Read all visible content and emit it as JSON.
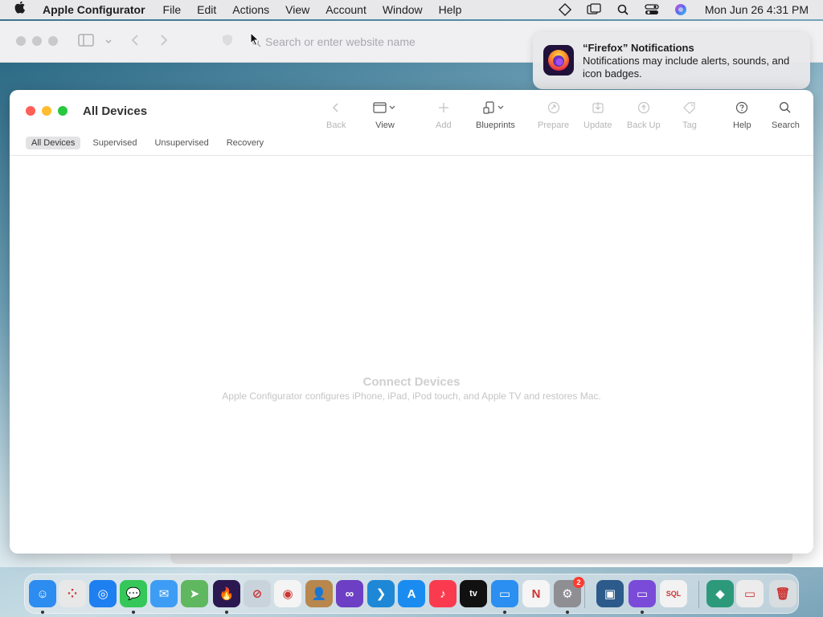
{
  "menubar": {
    "app_name": "Apple Configurator",
    "menus": [
      "File",
      "Edit",
      "Actions",
      "View",
      "Account",
      "Window",
      "Help"
    ],
    "clock": "Mon Jun 26  4:31 PM"
  },
  "safari": {
    "url_placeholder": "Search or enter website name"
  },
  "notification": {
    "title": "“Firefox” Notifications",
    "body": "Notifications may include alerts, sounds, and icon badges."
  },
  "window": {
    "title": "All Devices",
    "toolbar": {
      "back": "Back",
      "view": "View",
      "add": "Add",
      "blueprints": "Blueprints",
      "prepare": "Prepare",
      "update": "Update",
      "backup": "Back Up",
      "tag": "Tag",
      "help": "Help",
      "search": "Search"
    },
    "tabs": [
      "All Devices",
      "Supervised",
      "Unsupervised",
      "Recovery"
    ],
    "active_tab": "All Devices",
    "empty_title": "Connect Devices",
    "empty_subtitle": "Apple Configurator configures iPhone, iPad, iPod touch, and Apple TV and restores Mac."
  },
  "dock": {
    "items": [
      {
        "name": "finder-icon",
        "color": "#2d8cf0",
        "glyph": "☺"
      },
      {
        "name": "launchpad-icon",
        "color": "#e8e8e8",
        "glyph": "⁘"
      },
      {
        "name": "safari-icon",
        "color": "#1e7ff0",
        "glyph": "◎"
      },
      {
        "name": "messages-icon",
        "color": "#35c759",
        "glyph": "💬"
      },
      {
        "name": "mail-icon",
        "color": "#3d9df5",
        "glyph": "✉"
      },
      {
        "name": "maps-icon",
        "color": "#5fb85f",
        "glyph": "➤"
      },
      {
        "name": "firefox-icon",
        "color": "#2b1850",
        "glyph": "🔥"
      },
      {
        "name": "network-utility-icon",
        "color": "#c8d3dc",
        "glyph": "⊘"
      },
      {
        "name": "chrome-icon",
        "color": "#f4f4f4",
        "glyph": "◉"
      },
      {
        "name": "contacts-icon",
        "color": "#b8874e",
        "glyph": "👤"
      },
      {
        "name": "visual-studio-icon",
        "color": "#6c3fc4",
        "glyph": "∞"
      },
      {
        "name": "vscode-icon",
        "color": "#1e88d6",
        "glyph": "❯"
      },
      {
        "name": "app-store-icon",
        "color": "#1a8cf0",
        "glyph": "A"
      },
      {
        "name": "music-icon",
        "color": "#fa3b4f",
        "glyph": "♪"
      },
      {
        "name": "apple-tv-icon",
        "color": "#111111",
        "glyph": "tv"
      },
      {
        "name": "keynote-icon",
        "color": "#2a8ff0",
        "glyph": "▭"
      },
      {
        "name": "news-icon",
        "color": "#f5f5f5",
        "glyph": "N"
      },
      {
        "name": "system-settings-icon",
        "color": "#8e8e93",
        "glyph": "⚙",
        "badge": "2"
      },
      {
        "name": "virtualbox-icon",
        "color": "#2c5a8a",
        "glyph": "▣"
      },
      {
        "name": "apple-configurator-icon",
        "color": "#7a4ad8",
        "glyph": "▭"
      },
      {
        "name": "sql-icon",
        "color": "#f2f2f2",
        "glyph": "SQL"
      },
      {
        "name": "network-icon",
        "color": "#2c9a7a",
        "glyph": "◆"
      },
      {
        "name": "preview-icon",
        "color": "#ececec",
        "glyph": "▭"
      },
      {
        "name": "trash-icon",
        "color": "#d8dde0",
        "glyph": "🗑"
      }
    ]
  }
}
